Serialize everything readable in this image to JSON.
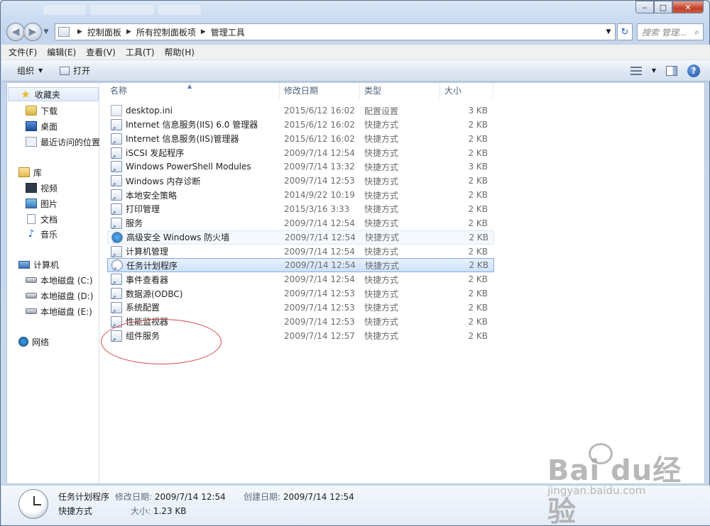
{
  "window": {
    "min": "‒",
    "max": "□",
    "close": "✕"
  },
  "address": {
    "crumbs": [
      "控制面板",
      "所有控制面板项",
      "管理工具"
    ],
    "search_placeholder": "搜索 管理..."
  },
  "menu": [
    "文件(F)",
    "编辑(E)",
    "查看(V)",
    "工具(T)",
    "帮助(H)"
  ],
  "toolbar": {
    "organize": "组织",
    "open": "打开"
  },
  "sidebar": {
    "favorites": "收藏夹",
    "fav_items": [
      "下载",
      "桌面",
      "最近访问的位置"
    ],
    "libraries": "库",
    "lib_items": [
      "视频",
      "图片",
      "文档",
      "音乐"
    ],
    "computer": "计算机",
    "drives": [
      "本地磁盘 (C:)",
      "本地磁盘 (D:)",
      "本地磁盘 (E:)"
    ],
    "network": "网络"
  },
  "columns": {
    "name": "名称",
    "date": "修改日期",
    "type": "类型",
    "size": "大小"
  },
  "files": [
    {
      "name": "desktop.ini",
      "date": "2015/6/12 16:02",
      "type": "配置设置",
      "size": "3 KB"
    },
    {
      "name": "Internet 信息服务(IIS) 6.0 管理器",
      "date": "2015/6/12 16:02",
      "type": "快捷方式",
      "size": "2 KB"
    },
    {
      "name": "Internet 信息服务(IIS)管理器",
      "date": "2015/6/12 16:02",
      "type": "快捷方式",
      "size": "2 KB"
    },
    {
      "name": "iSCSI 发起程序",
      "date": "2009/7/14 12:54",
      "type": "快捷方式",
      "size": "2 KB"
    },
    {
      "name": "Windows PowerShell Modules",
      "date": "2009/7/14 13:32",
      "type": "快捷方式",
      "size": "3 KB"
    },
    {
      "name": "Windows 内存诊断",
      "date": "2009/7/14 12:53",
      "type": "快捷方式",
      "size": "2 KB"
    },
    {
      "name": "本地安全策略",
      "date": "2014/9/22 10:19",
      "type": "快捷方式",
      "size": "2 KB"
    },
    {
      "name": "打印管理",
      "date": "2015/3/16 3:33",
      "type": "快捷方式",
      "size": "2 KB"
    },
    {
      "name": "服务",
      "date": "2009/7/14 12:54",
      "type": "快捷方式",
      "size": "2 KB"
    },
    {
      "name": "高级安全 Windows 防火墙",
      "date": "2009/7/14 12:54",
      "type": "快捷方式",
      "size": "2 KB"
    },
    {
      "name": "计算机管理",
      "date": "2009/7/14 12:54",
      "type": "快捷方式",
      "size": "2 KB"
    },
    {
      "name": "任务计划程序",
      "date": "2009/7/14 12:54",
      "type": "快捷方式",
      "size": "2 KB"
    },
    {
      "name": "事件查看器",
      "date": "2009/7/14 12:54",
      "type": "快捷方式",
      "size": "2 KB"
    },
    {
      "name": "数据源(ODBC)",
      "date": "2009/7/14 12:53",
      "type": "快捷方式",
      "size": "2 KB"
    },
    {
      "name": "系统配置",
      "date": "2009/7/14 12:53",
      "type": "快捷方式",
      "size": "2 KB"
    },
    {
      "name": "性能监视器",
      "date": "2009/7/14 12:53",
      "type": "快捷方式",
      "size": "2 KB"
    },
    {
      "name": "组件服务",
      "date": "2009/7/14 12:57",
      "type": "快捷方式",
      "size": "2 KB"
    }
  ],
  "selected_index": 11,
  "hover_index": 9,
  "details": {
    "name": "任务计划程序",
    "kind": "快捷方式",
    "mod_label": "修改日期:",
    "mod_value": "2009/7/14 12:54",
    "create_label": "创建日期:",
    "create_value": "2009/7/14 12:54",
    "size_label": "大小:",
    "size_value": "1.23 KB"
  },
  "watermark": {
    "brand": "Bai  du经验",
    "url": "jingyan.baidu.com"
  }
}
